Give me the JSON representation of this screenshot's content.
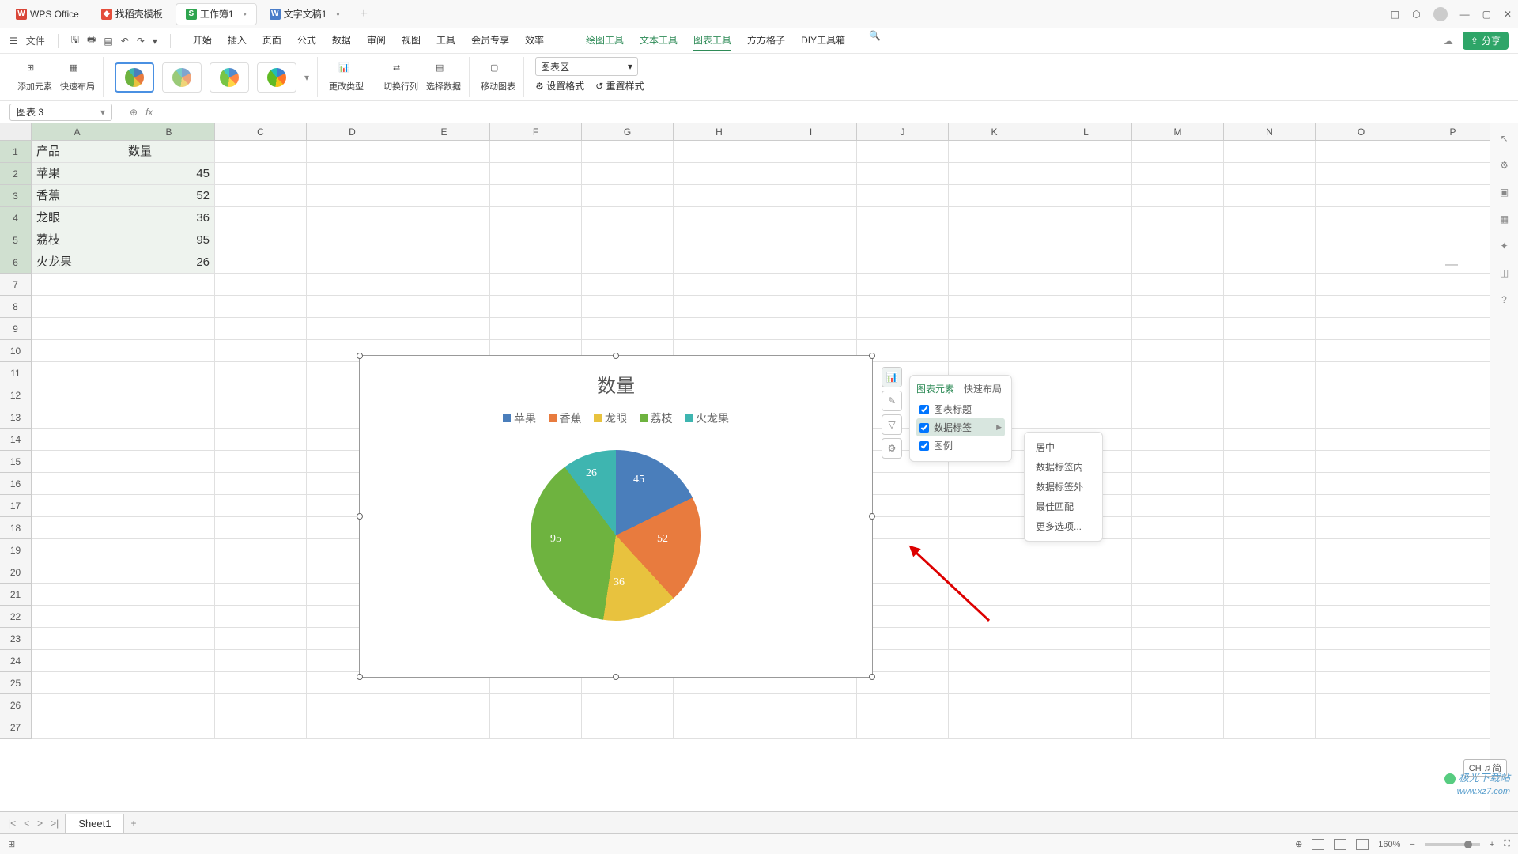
{
  "titlebar": {
    "tabs": [
      {
        "icon": "W",
        "label": "WPS Office"
      },
      {
        "icon": "D",
        "label": "找稻壳模板"
      },
      {
        "icon": "S",
        "label": "工作簿1",
        "active": true,
        "dirty": true
      },
      {
        "icon": "W",
        "label": "文字文稿1",
        "dirty": true
      }
    ],
    "add": "+"
  },
  "menubar": {
    "file": "文件",
    "tabs": [
      "开始",
      "插入",
      "页面",
      "公式",
      "数据",
      "审阅",
      "视图",
      "工具",
      "会员专享",
      "效率"
    ],
    "tools": [
      "绘图工具",
      "文本工具",
      "图表工具",
      "方方格子",
      "DIY工具箱"
    ],
    "active_tool": "图表工具",
    "share": "分享"
  },
  "toolbar": {
    "add_element": "添加元素",
    "quick_layout": "快速布局",
    "change_type": "更改类型",
    "switch_rc": "切换行列",
    "select_data": "选择数据",
    "move_chart": "移动图表",
    "chart_area": "图表区",
    "set_format": "设置格式",
    "reset_style": "重置样式"
  },
  "formulabar": {
    "name": "图表 3",
    "fx": "fx"
  },
  "columns": [
    "A",
    "B",
    "C",
    "D",
    "E",
    "F",
    "G",
    "H",
    "I",
    "J",
    "K",
    "L",
    "M",
    "N",
    "O",
    "P"
  ],
  "rows_count": 27,
  "cells": {
    "A1": "产品",
    "B1": "数量",
    "A2": "苹果",
    "B2": "45",
    "A3": "香蕉",
    "B3": "52",
    "A4": "龙眼",
    "B4": "36",
    "A5": "荔枝",
    "B5": "95",
    "A6": "火龙果",
    "B6": "26"
  },
  "chart_data": {
    "type": "pie",
    "title": "数量",
    "categories": [
      "苹果",
      "香蕉",
      "龙眼",
      "荔枝",
      "火龙果"
    ],
    "values": [
      45,
      52,
      36,
      95,
      26
    ],
    "colors": [
      "#4a7ebb",
      "#e87b3e",
      "#e8c23e",
      "#6eb33f",
      "#3eb5b0"
    ],
    "data_labels": true,
    "legend_position": "top"
  },
  "chart_popup": {
    "tab_elements": "图表元素",
    "tab_layouts": "快速布局",
    "opt_title": "图表标题",
    "opt_datalabel": "数据标签",
    "opt_legend": "图例",
    "submenu": [
      "居中",
      "数据标签内",
      "数据标签外",
      "最佳匹配",
      "更多选项..."
    ]
  },
  "sheet": {
    "name": "Sheet1"
  },
  "statusbar": {
    "zoom": "160%"
  },
  "ime": "CH ♫ 简",
  "watermark": {
    "brand": "极光下载站",
    "url": "www.xz7.com"
  }
}
